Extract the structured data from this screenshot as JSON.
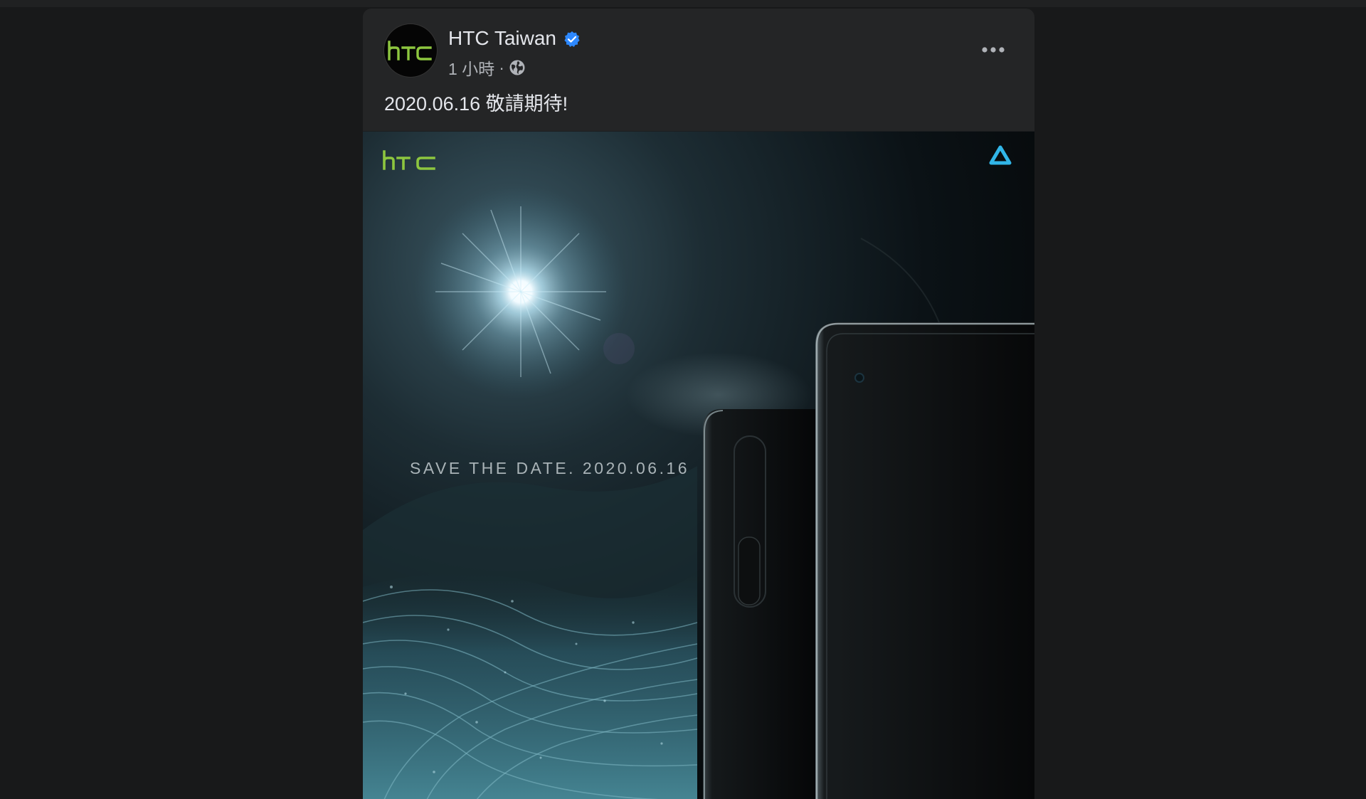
{
  "post": {
    "author": "HTC Taiwan",
    "time": "1 小時",
    "separator": "·",
    "text": "2020.06.16  敬請期待!",
    "avatar_logo": "htc",
    "visibility_icon": "globe-icon",
    "verified_icon": "verified-badge-icon",
    "more_icon": "more-options-icon"
  },
  "image": {
    "brand_logo": "htc",
    "vive_logo": "vive-logo-icon",
    "tagline": "SAVE THE DATE. 2020.06.16"
  },
  "colors": {
    "page_background": "#18191a",
    "card_background": "#242526",
    "primary_text": "#e4e6eb",
    "secondary_text": "#b0b3b8",
    "verified_blue": "#2d88ff",
    "htc_green": "#8dc63f",
    "vive_blue": "#31b6e8"
  }
}
